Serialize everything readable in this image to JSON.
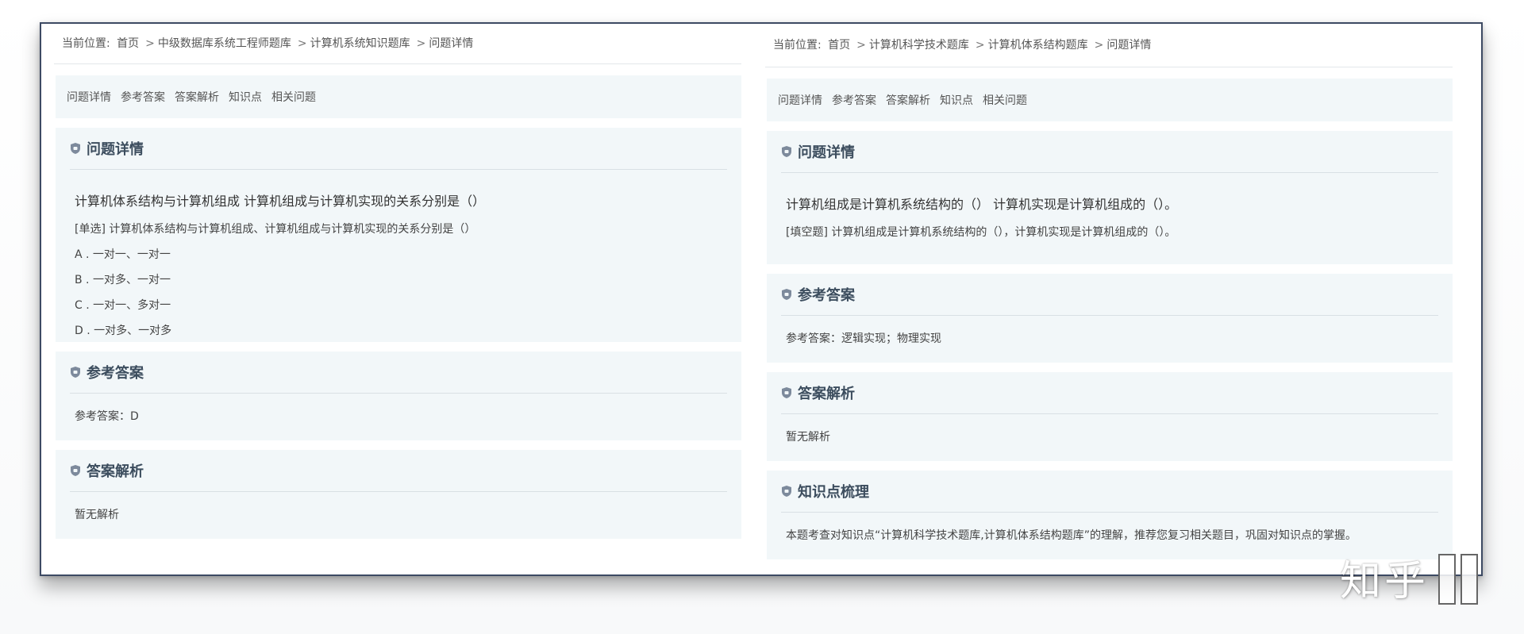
{
  "left": {
    "breadcrumb": {
      "prefix": "当前位置:",
      "items": [
        "首页",
        "中级数据库系统工程师题库",
        "计算机系统知识题库",
        "问题详情"
      ]
    },
    "tabs": [
      "问题详情",
      "参考答案",
      "答案解析",
      "知识点",
      "相关问题"
    ],
    "question_section": {
      "title": "问题详情",
      "question_title": "计算机体系结构与计算机组成 计算机组成与计算机实现的关系分别是（）",
      "question_text": "[单选] 计算机体系结构与计算机组成、计算机组成与计算机实现的关系分别是（）",
      "options": [
        "A . 一对一、一对一",
        "B . 一对多、一对一",
        "C . 一对一、多对一",
        "D . 一对多、一对多"
      ]
    },
    "answer_section": {
      "title": "参考答案",
      "text": "参考答案：D"
    },
    "analysis_section": {
      "title": "答案解析",
      "text": "暂无解析"
    }
  },
  "right": {
    "breadcrumb": {
      "prefix": "当前位置:",
      "items": [
        "首页",
        "计算机科学技术题库",
        "计算机体系结构题库",
        "问题详情"
      ]
    },
    "tabs": [
      "问题详情",
      "参考答案",
      "答案解析",
      "知识点",
      "相关问题"
    ],
    "question_section": {
      "title": "问题详情",
      "question_title": "计算机组成是计算机系统结构的（） 计算机实现是计算机组成的（）。",
      "question_text": "[填空题] 计算机组成是计算机系统结构的（），计算机实现是计算机组成的（）。"
    },
    "answer_section": {
      "title": "参考答案",
      "text": "参考答案：逻辑实现；物理实现"
    },
    "analysis_section": {
      "title": "答案解析",
      "text": "暂无解析"
    },
    "knowledge_section": {
      "title": "知识点梳理",
      "text": "本题考查对知识点“计算机科学技术题库,计算机体系结构题库”的理解，推荐您复习相关题目，巩固对知识点的掌握。"
    }
  },
  "watermark": {
    "text": "知乎"
  },
  "colors": {
    "frame_border": "#3d4a63",
    "panel_bg": "#f2f7f9",
    "section_title": "#3c4d5e",
    "icon": "#7d8a9c"
  },
  "icons": {
    "section_icon": "shield-badge-icon"
  }
}
